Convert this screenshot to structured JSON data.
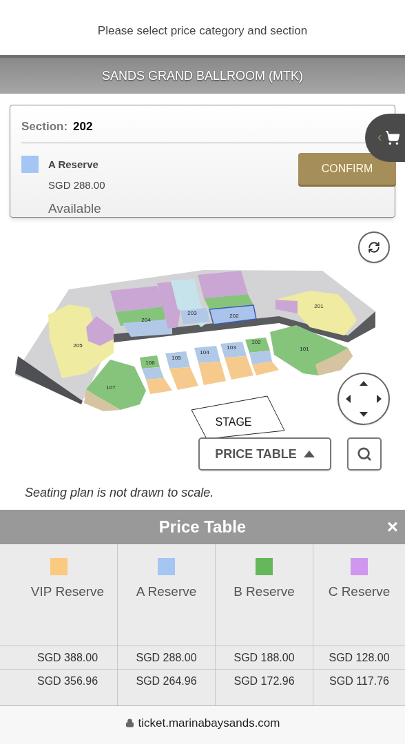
{
  "header": {
    "instruction": "Please select price category and section"
  },
  "venue": {
    "title": "SANDS GRAND BALLROOM (MTK)"
  },
  "selection": {
    "section_label": "Section:",
    "section_value": "202",
    "category": "A Reserve",
    "color": "#a4c6f2",
    "price": "SGD 288.00",
    "status": "Available",
    "confirm": "CONFIRM"
  },
  "map": {
    "sections": [
      {
        "label": "205",
        "selected": false
      },
      {
        "label": "204",
        "selected": false
      },
      {
        "label": "203",
        "selected": false
      },
      {
        "label": "202",
        "selected": true
      },
      {
        "label": "201",
        "selected": false
      },
      {
        "label": "101",
        "selected": false
      },
      {
        "label": "102",
        "selected": false
      },
      {
        "label": "103",
        "selected": false
      },
      {
        "label": "104",
        "selected": false
      },
      {
        "label": "105",
        "selected": false
      },
      {
        "label": "106",
        "selected": false
      },
      {
        "label": "107",
        "selected": false
      }
    ],
    "stage": "STAGE",
    "price_table_button": "PRICE TABLE",
    "note": "Seating plan is not drawn to scale."
  },
  "price_table": {
    "title": "Price Table",
    "close": "×",
    "columns": [
      {
        "name": "VIP Reserve",
        "color": "#fbc97f",
        "prices": [
          "SGD 388.00",
          "SGD 356.96"
        ]
      },
      {
        "name": "A Reserve",
        "color": "#a4c6f2",
        "prices": [
          "SGD 288.00",
          "SGD 264.96"
        ]
      },
      {
        "name": "B Reserve",
        "color": "#66b65c",
        "prices": [
          "SGD 188.00",
          "SGD 172.96"
        ]
      },
      {
        "name": "C Reserve",
        "color": "#cf97ef",
        "prices": [
          "SGD 128.00",
          "SGD 117.76"
        ]
      }
    ]
  },
  "address_bar": {
    "url": "ticket.marinabaysands.com"
  }
}
